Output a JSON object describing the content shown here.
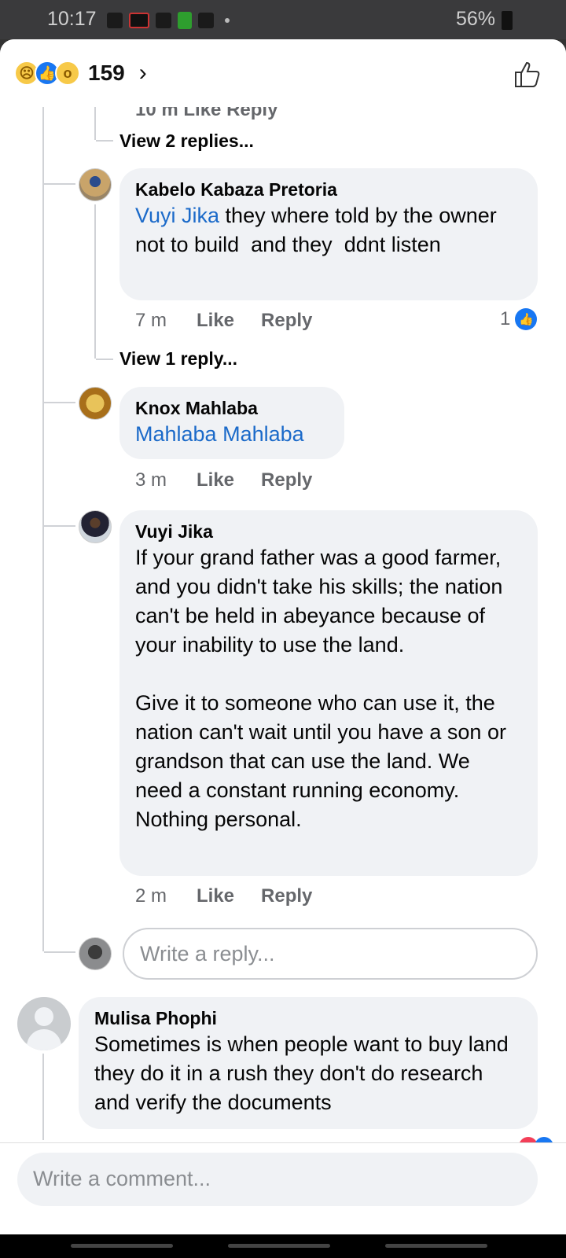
{
  "status_bar": {
    "time": "10:17",
    "battery": "56%"
  },
  "header": {
    "reaction_count": "159",
    "reaction_icons": [
      "sad-icon",
      "like-icon",
      "wow-icon"
    ]
  },
  "thread": {
    "partial_meta": "10 m   Like   Reply",
    "view_replies_1": "View 2 replies...",
    "view_replies_2": "View 1 reply...",
    "comments": [
      {
        "author": "Kabelo Kabaza Pretoria",
        "mention": "Vuyi Jika",
        "text": " they where told by the owner not to build  and they  ddnt listen",
        "time": "7 m",
        "like": "Like",
        "reply": "Reply",
        "likes": "1"
      },
      {
        "author": "Knox Mahlaba",
        "mention": "Mahlaba Mahlaba",
        "text": "",
        "time": "3 m",
        "like": "Like",
        "reply": "Reply"
      },
      {
        "author": "Vuyi Jika",
        "text": "If your grand father was a good farmer, and you didn't take his skills; the nation can't be held in abeyance because of your inability to use the land.\n\nGive it to someone who can use it, the nation can't wait until you have a son or grandson that can use the land. We need a constant running economy. Nothing personal.",
        "time": "2 m",
        "like": "Like",
        "reply": "Reply"
      }
    ],
    "reply_placeholder": "Write a reply...",
    "top_comment": {
      "author": "Mulisa Phophi",
      "text": "Sometimes is when people want to buy land they do it in a rush they don't do research and verify the documents"
    }
  },
  "footer": {
    "comment_placeholder": "Write a comment..."
  },
  "colors": {
    "mention": "#1b6ac9",
    "like_blue": "#1877f2",
    "bubble": "#f0f2f5"
  }
}
